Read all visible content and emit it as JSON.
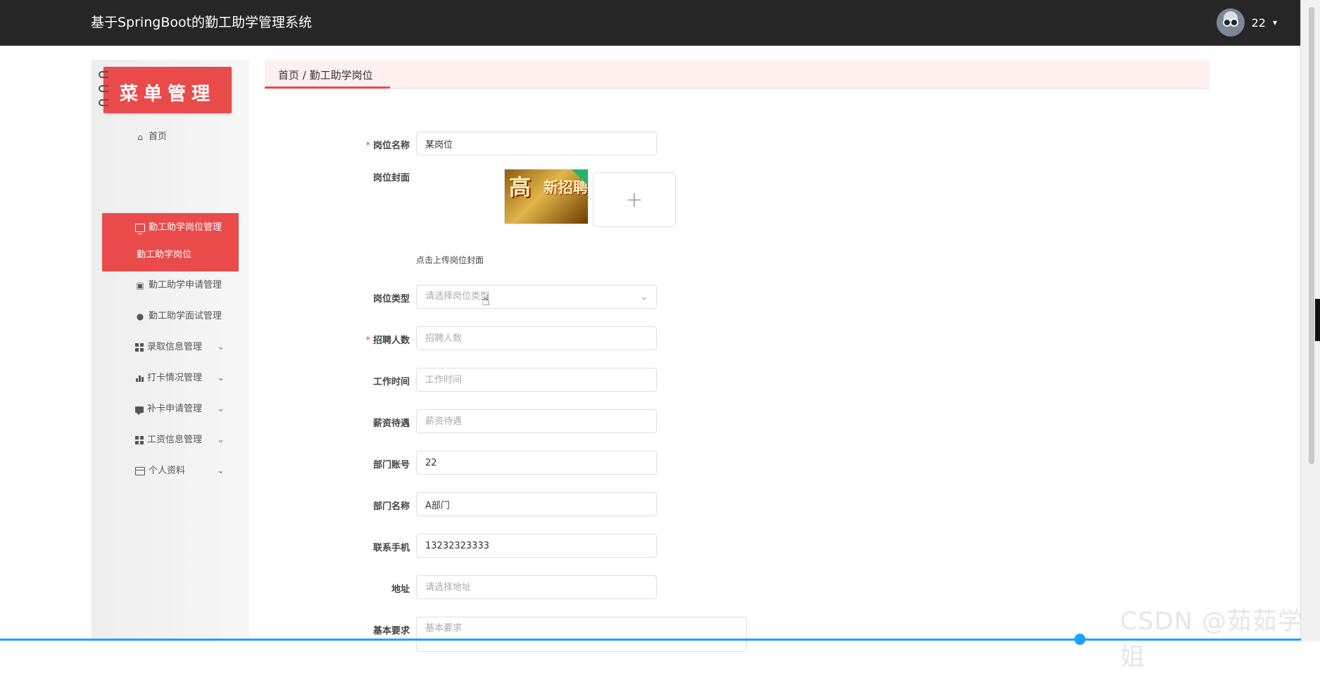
{
  "header": {
    "app_title": "基于SpringBoot的勤工助学管理系统",
    "username": "22",
    "caret": "▾"
  },
  "sidebar": {
    "heading": "菜单管理",
    "items": [
      {
        "label": "首页",
        "icon": "home-icon"
      },
      {
        "label": "勤工助学岗位管理",
        "icon": "monitor-icon"
      },
      {
        "label": "勤工助学岗位",
        "icon": ""
      },
      {
        "label": "勤工助学申请管理",
        "icon": "chart-icon"
      },
      {
        "label": "勤工助学面试管理",
        "icon": "user-icon"
      },
      {
        "label": "录取信息管理",
        "icon": "grid-icon",
        "chevron": "⌄"
      },
      {
        "label": "打卡情况管理",
        "icon": "bar-chart-icon",
        "chevron": "⌄"
      },
      {
        "label": "补卡申请管理",
        "icon": "chat-icon",
        "chevron": "⌄"
      },
      {
        "label": "工资信息管理",
        "icon": "grid-icon",
        "chevron": "⌄"
      },
      {
        "label": "个人资料",
        "icon": "card-icon",
        "chevron": "⌄"
      }
    ]
  },
  "breadcrumb": {
    "text": "首页 / 勤工助学岗位"
  },
  "form": {
    "job_name": {
      "label": "岗位名称",
      "value": "某岗位",
      "required": "*"
    },
    "cover": {
      "label": "岗位封面",
      "hint": "点击上传岗位封面",
      "thumb_big": "高",
      "thumb_small": "新招聘",
      "plus": "+"
    },
    "job_type": {
      "label": "岗位类型",
      "placeholder": "请选择岗位类型",
      "arrow": "⌄"
    },
    "hiring_count": {
      "label": "招聘人数",
      "placeholder": "招聘人数",
      "required": "*"
    },
    "work_time": {
      "label": "工作时间",
      "placeholder": "工作时间"
    },
    "salary": {
      "label": "薪资待遇",
      "placeholder": "薪资待遇"
    },
    "dept_account": {
      "label": "部门账号",
      "value": "22"
    },
    "dept_name": {
      "label": "部门名称",
      "value": "A部门"
    },
    "phone": {
      "label": "联系手机",
      "value": "13232323333"
    },
    "address": {
      "label": "地址",
      "placeholder": "请选择地址"
    },
    "requirements": {
      "label": "基本要求",
      "placeholder": "基本要求"
    }
  },
  "misc": {
    "watermark": "CSDN @茹茹学姐",
    "accent": "#e94b4b",
    "topbar": "#262626"
  }
}
